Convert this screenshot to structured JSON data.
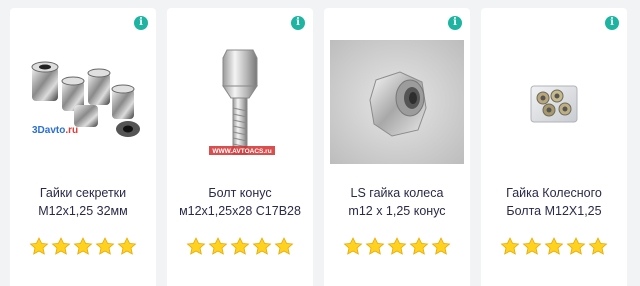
{
  "products": [
    {
      "title_line1": "Гайки секретки",
      "title_line2": "М12х1,25 32мм",
      "info_icon": "i",
      "watermark": "3Davto",
      "rating": 5
    },
    {
      "title_line1": "Болт конус",
      "title_line2": "м12х1,25х28 С17В28",
      "info_icon": "i",
      "watermark": "WWW.AVTOACS.ru",
      "rating": 5
    },
    {
      "title_line1": "LS гайка колеса",
      "title_line2": "m12 x 1,25 конус",
      "info_icon": "i",
      "rating": 5
    },
    {
      "title_line1": "Гайка Колесного",
      "title_line2": "Болта М12Х1,25",
      "info_icon": "i",
      "rating": 5
    }
  ],
  "colors": {
    "info_badge": "#1db4a2",
    "star": "#ffd21f",
    "title_text": "#2a2a4a"
  }
}
